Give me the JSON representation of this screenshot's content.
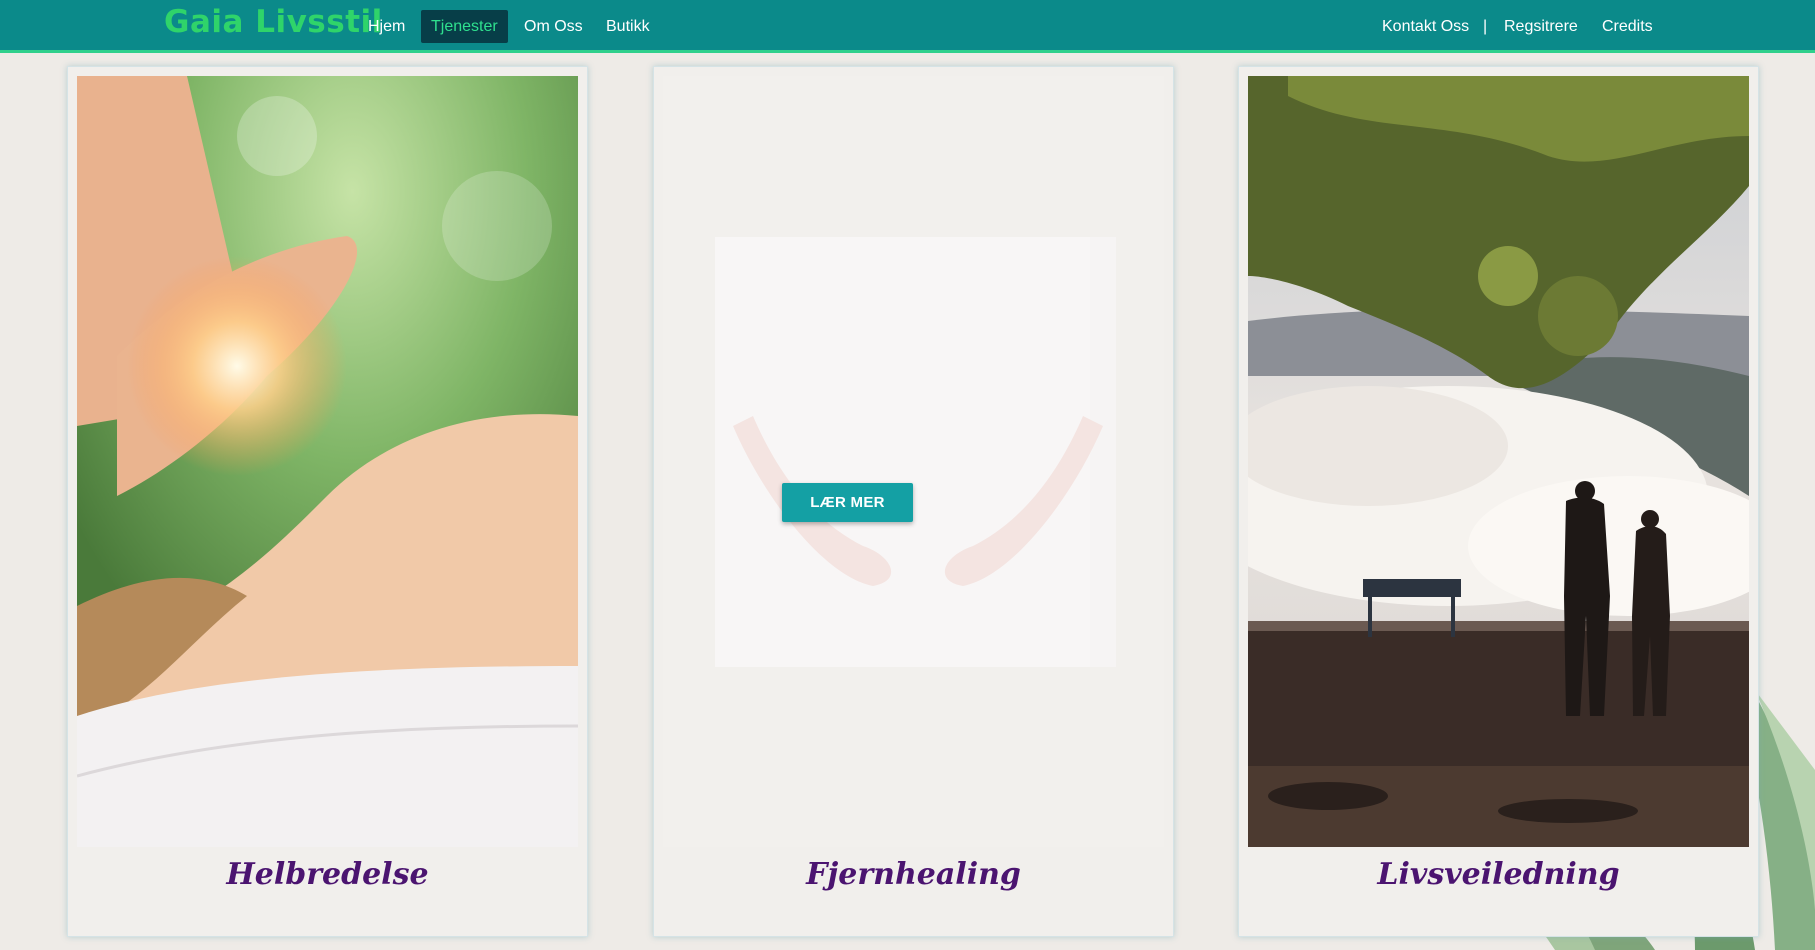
{
  "brand": "Gaia Livsstil",
  "nav": {
    "left": [
      {
        "label": "Hjem",
        "active": false
      },
      {
        "label": "Tjenester",
        "active": true
      },
      {
        "label": "Om Oss",
        "active": false
      },
      {
        "label": "Butikk",
        "active": false
      }
    ],
    "right": [
      {
        "label": "Kontakt Oss"
      },
      {
        "label": "Regsitrere"
      },
      {
        "label": "Credits"
      }
    ],
    "separator": "|"
  },
  "cards": [
    {
      "title": "Helbredelse",
      "image": "reiki-healing-photo"
    },
    {
      "title": "Fjernhealing",
      "image": "cupped-hands-photo",
      "button_label": "LÆR MER"
    },
    {
      "title": "Livsveiledning",
      "image": "mountain-view-photo"
    }
  ],
  "colors": {
    "navbar": "#0b8a8a",
    "brand": "#2fd46a",
    "active_tab_bg": "#073e48",
    "active_tab_text": "#2fe08e",
    "button": "#14a0a4",
    "card_title": "#4b1470"
  }
}
